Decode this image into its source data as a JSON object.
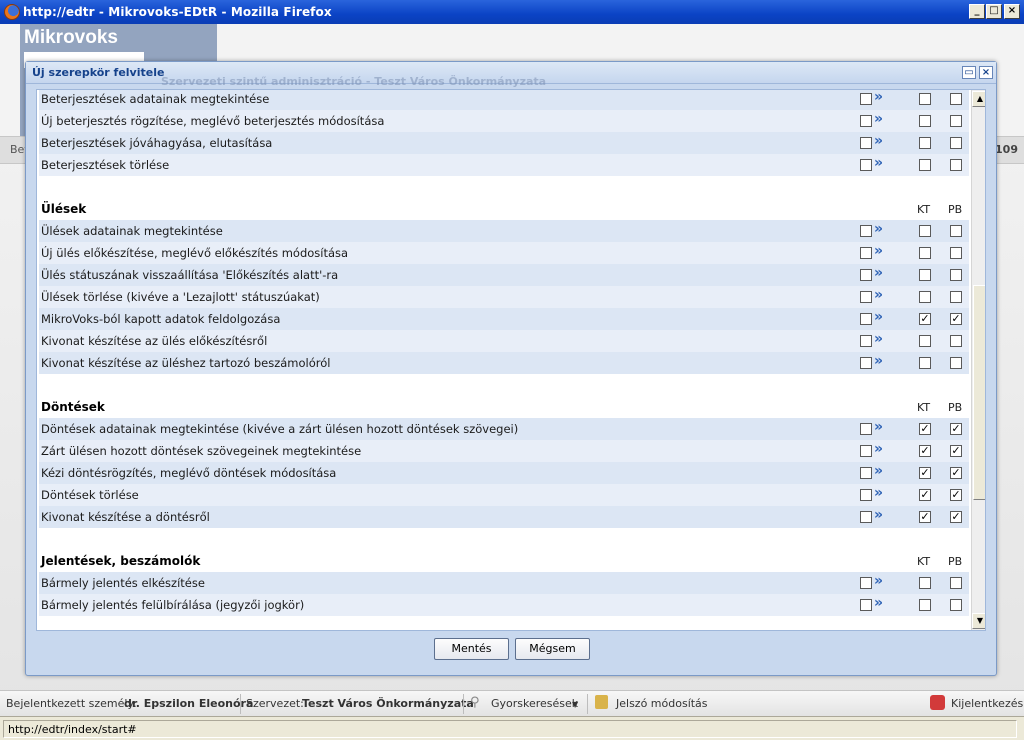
{
  "browser": {
    "window_title": "http://edtr - Mikrovoks-EDtR - Mozilla Firefox",
    "status_url": "http://edtr/index/start#"
  },
  "app": {
    "logo": "Mikrovoks",
    "bg_crumb": "Bet",
    "bg_count": "109"
  },
  "modal": {
    "title": "Új szerepkör felvitele",
    "ghost_title": "Szervezeti szintű adminisztráció - Teszt Város Önkormányzata",
    "save_label": "Mentés",
    "cancel_label": "Mégsem"
  },
  "columns": {
    "kt": "KT",
    "pb": "PB"
  },
  "sections": [
    {
      "title": "",
      "rows": [
        {
          "label": "Beterjesztések adatainak megtekintése",
          "kt": false,
          "pb": false
        },
        {
          "label": "Új beterjesztés rögzítése, meglévő beterjesztés módosítása",
          "kt": false,
          "pb": false
        },
        {
          "label": "Beterjesztések jóváhagyása, elutasítása",
          "kt": false,
          "pb": false
        },
        {
          "label": "Beterjesztések törlése",
          "kt": false,
          "pb": false
        }
      ]
    },
    {
      "title": "Ülések",
      "rows": [
        {
          "label": "Ülések adatainak megtekintése",
          "kt": false,
          "pb": false
        },
        {
          "label": "Új ülés előkészítése, meglévő előkészítés módosítása",
          "kt": false,
          "pb": false
        },
        {
          "label": "Ülés státuszának visszaállítása 'Előkészítés alatt'-ra",
          "kt": false,
          "pb": false
        },
        {
          "label": "Ülések törlése (kivéve a 'Lezajlott' státuszúakat)",
          "kt": false,
          "pb": false
        },
        {
          "label": "MikroVoks-ból kapott adatok feldolgozása",
          "kt": true,
          "pb": true
        },
        {
          "label": "Kivonat készítése az ülés előkészítésről",
          "kt": false,
          "pb": false
        },
        {
          "label": "Kivonat készítése az üléshez tartozó beszámolóról",
          "kt": false,
          "pb": false
        }
      ]
    },
    {
      "title": "Döntések",
      "rows": [
        {
          "label": "Döntések adatainak megtekintése (kivéve a zárt ülésen hozott döntések szövegei)",
          "kt": true,
          "pb": true
        },
        {
          "label": "Zárt ülésen hozott döntések szövegeinek megtekintése",
          "kt": true,
          "pb": true
        },
        {
          "label": "Kézi döntésrögzítés, meglévő döntések módosítása",
          "kt": true,
          "pb": true
        },
        {
          "label": "Döntések törlése",
          "kt": true,
          "pb": true
        },
        {
          "label": "Kivonat készítése a döntésről",
          "kt": true,
          "pb": true
        }
      ]
    },
    {
      "title": "Jelentések, beszámolók",
      "rows": [
        {
          "label": "Bármely jelentés elkészítése",
          "kt": false,
          "pb": false
        },
        {
          "label": "Bármely jelentés felülbírálása (jegyzői jogkör)",
          "kt": false,
          "pb": false
        }
      ]
    }
  ],
  "status_bar": {
    "user_label": "Bejelentkezett személy:",
    "user_name": "dr. Epszilon Eleonóra",
    "org_label": "Szervezet:",
    "org_name": "Teszt Város Önkormányzata",
    "quick_search": "Gyorskeresések",
    "password_change": "Jelszó módosítás",
    "logout": "Kijelentkezés"
  },
  "icons": {
    "expand": "double-chevron-right-icon",
    "check": "check-icon"
  }
}
